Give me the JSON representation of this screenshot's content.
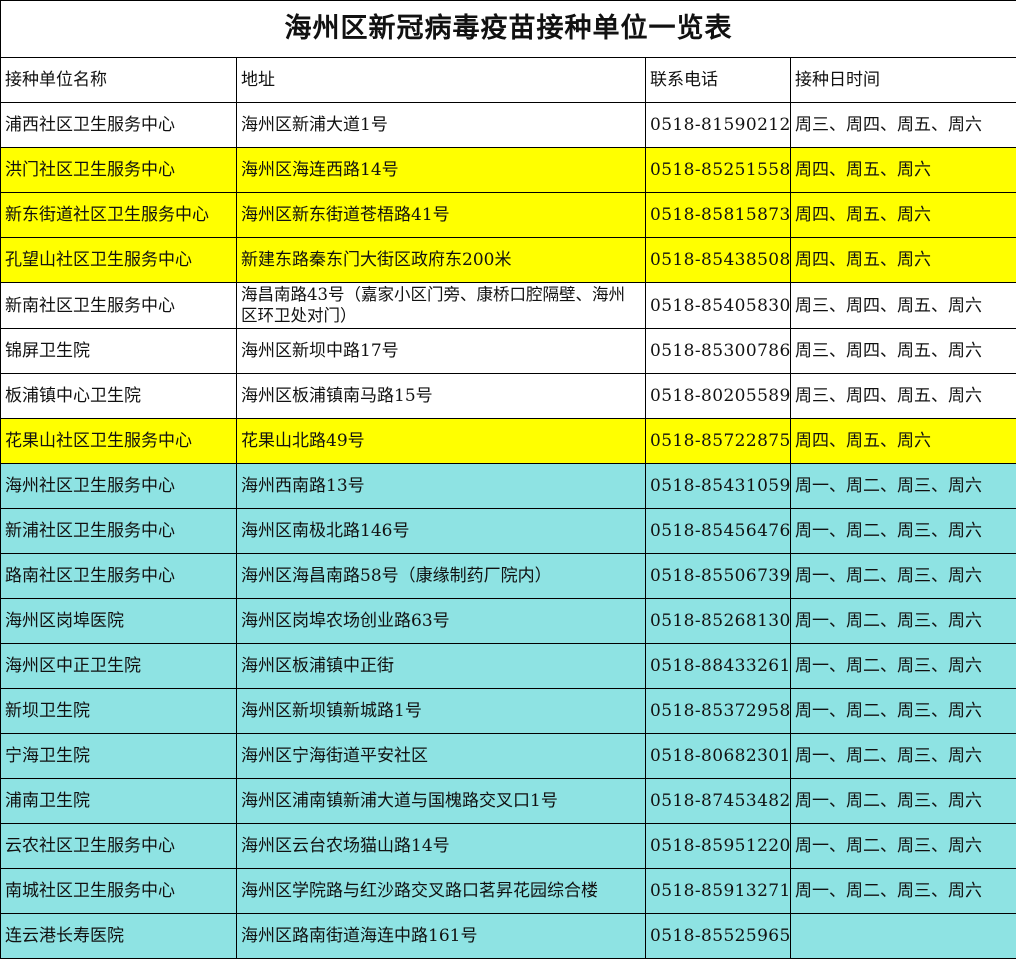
{
  "title": "海州区新冠病毒疫苗接种单位一览表",
  "colors": {
    "yellow": "#ffff00",
    "cyan": "#8ee3e3",
    "white": "#ffffff"
  },
  "headers": [
    "接种单位名称",
    "地址",
    "联系电话",
    "接种日时间"
  ],
  "rows": [
    {
      "bg": "white",
      "name": "浦西社区卫生服务中心",
      "address": "海州区新浦大道1号",
      "phone": "0518-81590212",
      "days": "周三、周四、周五、周六"
    },
    {
      "bg": "yellow",
      "name": "洪门社区卫生服务中心",
      "address": "海州区海连西路14号",
      "phone": "0518-85251558",
      "days": "周四、周五、周六"
    },
    {
      "bg": "yellow",
      "name": "新东街道社区卫生服务中心",
      "address": "海州区新东街道苍梧路41号",
      "phone": "0518-85815873",
      "days": "周四、周五、周六"
    },
    {
      "bg": "yellow",
      "name": "孔望山社区卫生服务中心",
      "address": "新建东路秦东门大街区政府东200米",
      "phone": "0518-85438508",
      "days": "周四、周五、周六"
    },
    {
      "bg": "white",
      "name": "新南社区卫生服务中心",
      "address": "海昌南路43号（嘉家小区门旁、康桥口腔隔壁、海州区环卫处对门）",
      "phone": "0518-85405830",
      "days": "周三、周四、周五、周六",
      "wrap": true
    },
    {
      "bg": "white",
      "name": "锦屏卫生院",
      "address": "海州区新坝中路17号",
      "phone": "0518-85300786",
      "days": "周三、周四、周五、周六"
    },
    {
      "bg": "white",
      "name": "板浦镇中心卫生院",
      "address": "海州区板浦镇南马路15号",
      "phone": "0518-80205589",
      "days": "周三、周四、周五、周六"
    },
    {
      "bg": "yellow",
      "name": "花果山社区卫生服务中心",
      "address": "花果山北路49号",
      "phone": "0518-85722875",
      "days": "周四、周五、周六"
    },
    {
      "bg": "cyan",
      "name": "海州社区卫生服务中心",
      "address": "海州西南路13号",
      "phone": "0518-85431059",
      "days": "周一、周二、周三、周六"
    },
    {
      "bg": "cyan",
      "name": "新浦社区卫生服务中心",
      "address": "海州区南极北路146号",
      "phone": "0518-85456476",
      "days": "周一、周二、周三、周六"
    },
    {
      "bg": "cyan",
      "name": "路南社区卫生服务中心",
      "address": "海州区海昌南路58号（康缘制药厂院内）",
      "phone": "0518-85506739",
      "days": "周一、周二、周三、周六"
    },
    {
      "bg": "cyan",
      "name": "海州区岗埠医院",
      "address": "海州区岗埠农场创业路63号",
      "phone": "0518-85268130",
      "days": "周一、周二、周三、周六"
    },
    {
      "bg": "cyan",
      "name": "海州区中正卫生院",
      "address": "海州区板浦镇中正街",
      "phone": "0518-88433261",
      "days": "周一、周二、周三、周六"
    },
    {
      "bg": "cyan",
      "name": "新坝卫生院",
      "address": "海州区新坝镇新城路1号",
      "phone": "0518-85372958",
      "days": "周一、周二、周三、周六"
    },
    {
      "bg": "cyan",
      "name": "宁海卫生院",
      "address": "海州区宁海街道平安社区",
      "phone": "0518-80682301",
      "days": "周一、周二、周三、周六"
    },
    {
      "bg": "cyan",
      "name": "浦南卫生院",
      "address": "海州区浦南镇新浦大道与国槐路交叉口1号",
      "phone": "0518-87453482",
      "days": "周一、周二、周三、周六"
    },
    {
      "bg": "cyan",
      "name": "云农社区卫生服务中心",
      "address": "海州区云台农场猫山路14号",
      "phone": "0518-85951220",
      "days": "周一、周二、周三、周六"
    },
    {
      "bg": "cyan",
      "name": "南城社区卫生服务中心",
      "address": "海州区学院路与红沙路交叉路口茗昇花园综合楼",
      "phone": "0518-85913271",
      "days": "周一、周二、周三、周六"
    },
    {
      "bg": "cyan",
      "name": "连云港长寿医院",
      "address": "海州区路南街道海连中路161号",
      "phone": "0518-85525965",
      "days": ""
    }
  ]
}
